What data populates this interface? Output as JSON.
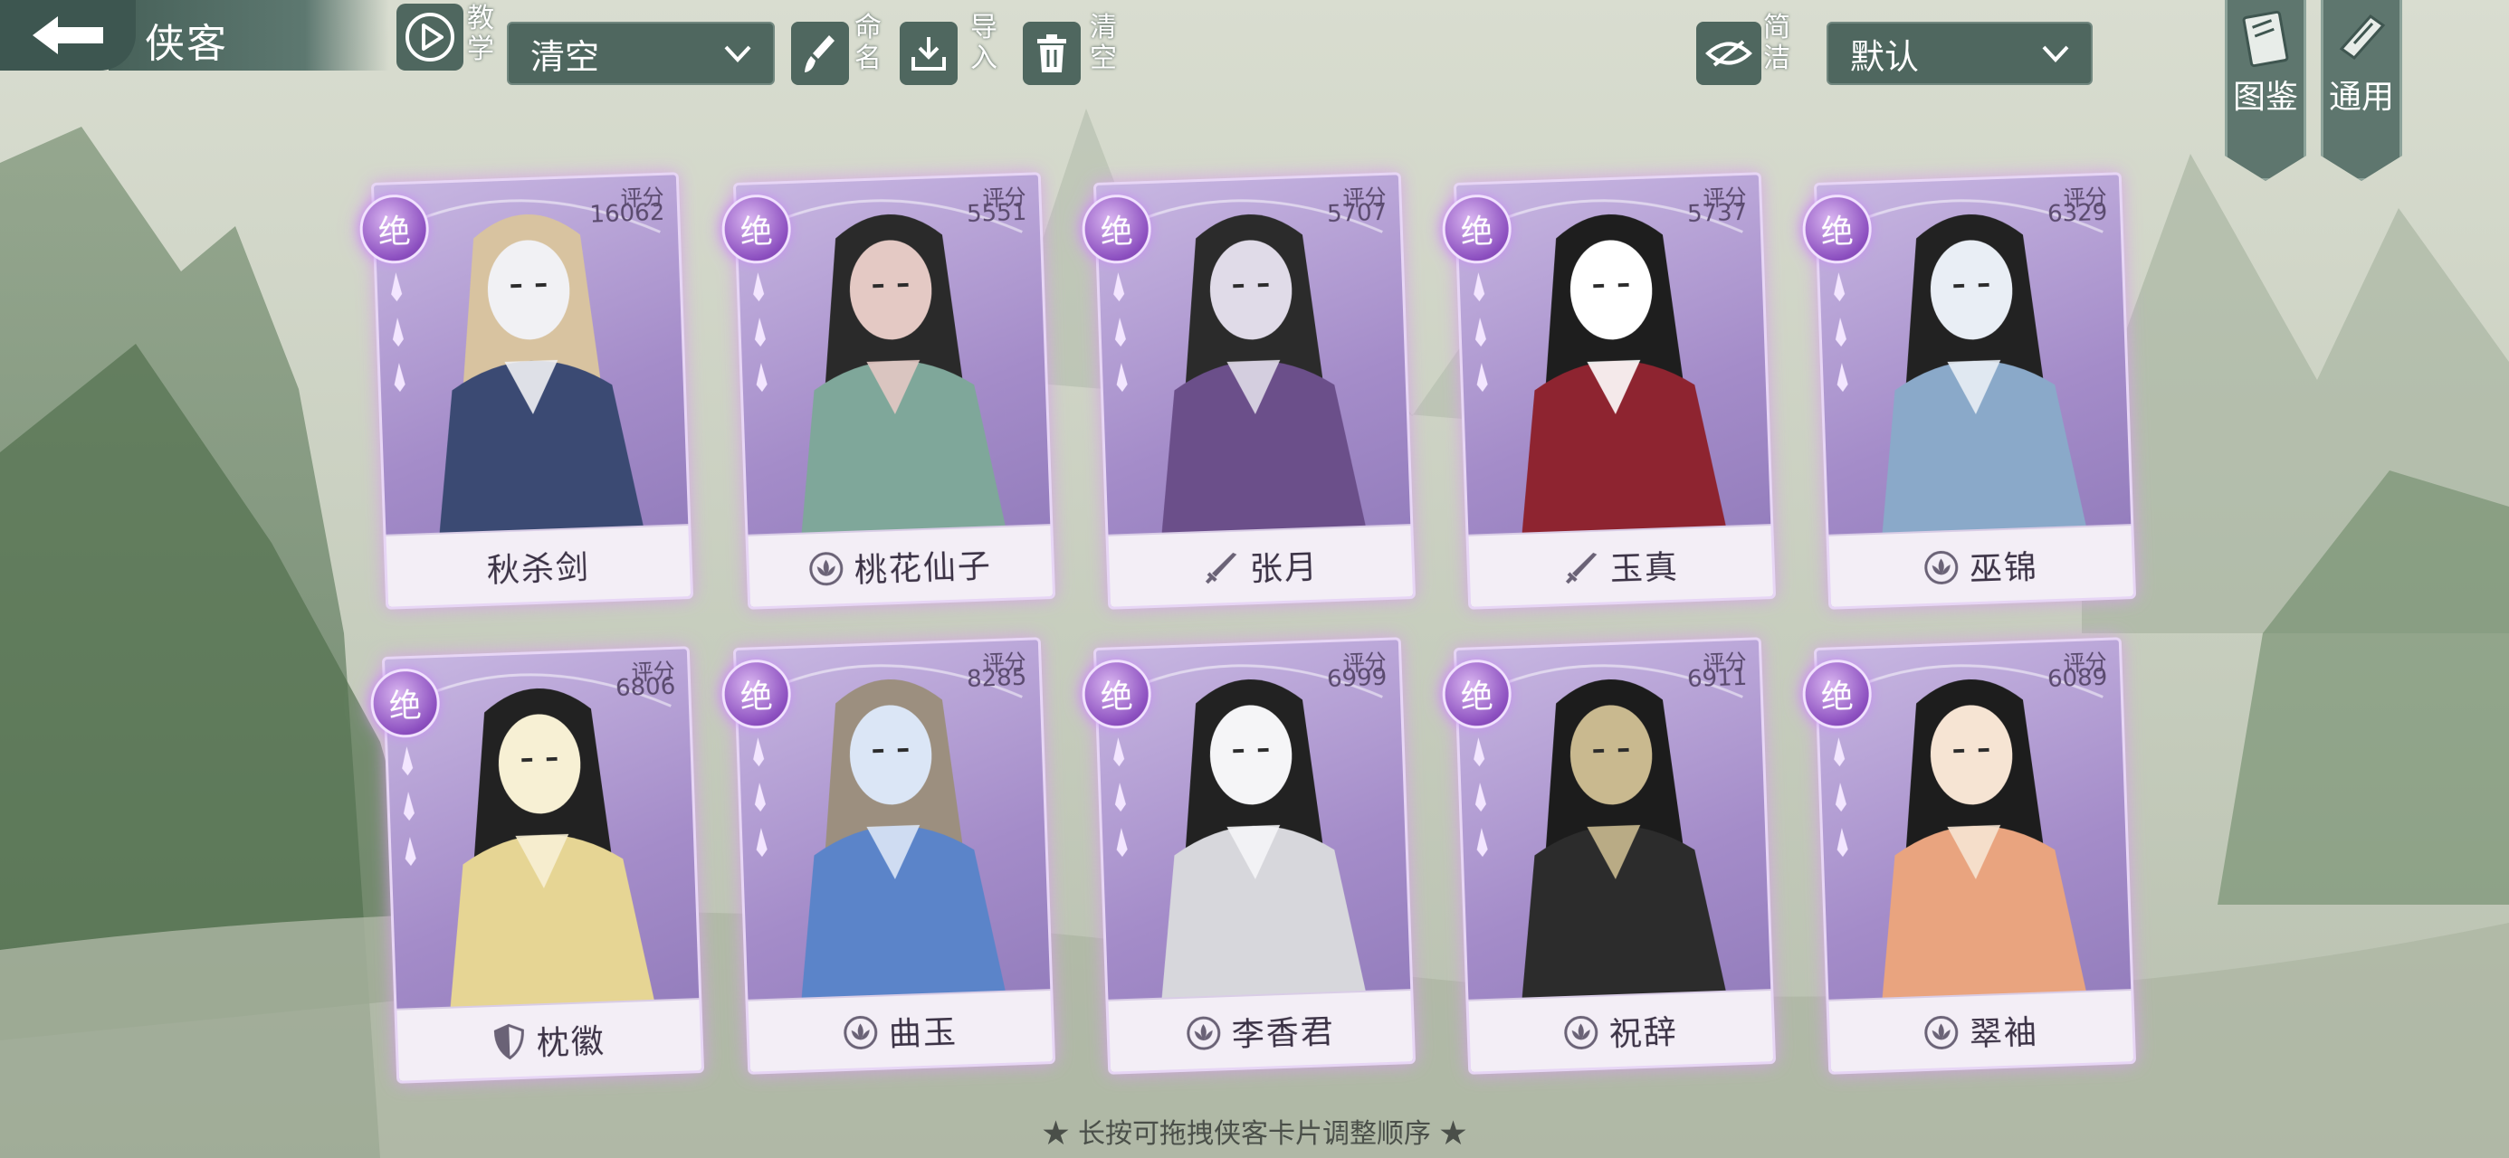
{
  "header": {
    "title": "侠客",
    "tutorial_label": "教学",
    "preset_select_value": "清空",
    "rename_label": "命名",
    "import_label": "导入",
    "clear_label": "清空",
    "simplify_label": "简洁",
    "sort_select_value": "默认",
    "codex_label": "图鉴",
    "general_label": "通用"
  },
  "score_label": "评分",
  "rank_label": "绝",
  "cards": [
    {
      "name": "秋杀剑",
      "score": "16062",
      "school_icon": "none"
    },
    {
      "name": "桃花仙子",
      "score": "5551",
      "school_icon": "lotus-icon"
    },
    {
      "name": "张月",
      "score": "5707",
      "school_icon": "sword-icon"
    },
    {
      "name": "玉真",
      "score": "5737",
      "school_icon": "sword-icon"
    },
    {
      "name": "巫锦",
      "score": "6329",
      "school_icon": "lotus-icon"
    },
    {
      "name": "枕徽",
      "score": "6806",
      "school_icon": "shield-icon"
    },
    {
      "name": "曲玉",
      "score": "8285",
      "school_icon": "lotus-icon"
    },
    {
      "name": "李香君",
      "score": "6999",
      "school_icon": "lotus-icon"
    },
    {
      "name": "祝辞",
      "score": "6911",
      "school_icon": "lotus-icon"
    },
    {
      "name": "翠袖",
      "score": "6089",
      "school_icon": "lotus-icon"
    }
  ],
  "hint": "★ 长按可拖拽侠客卡片调整顺序 ★",
  "colors": {
    "rank_purple": "#8c4fc0",
    "card_purple": "#a48cc9",
    "toolbar_green": "#4f675f"
  }
}
